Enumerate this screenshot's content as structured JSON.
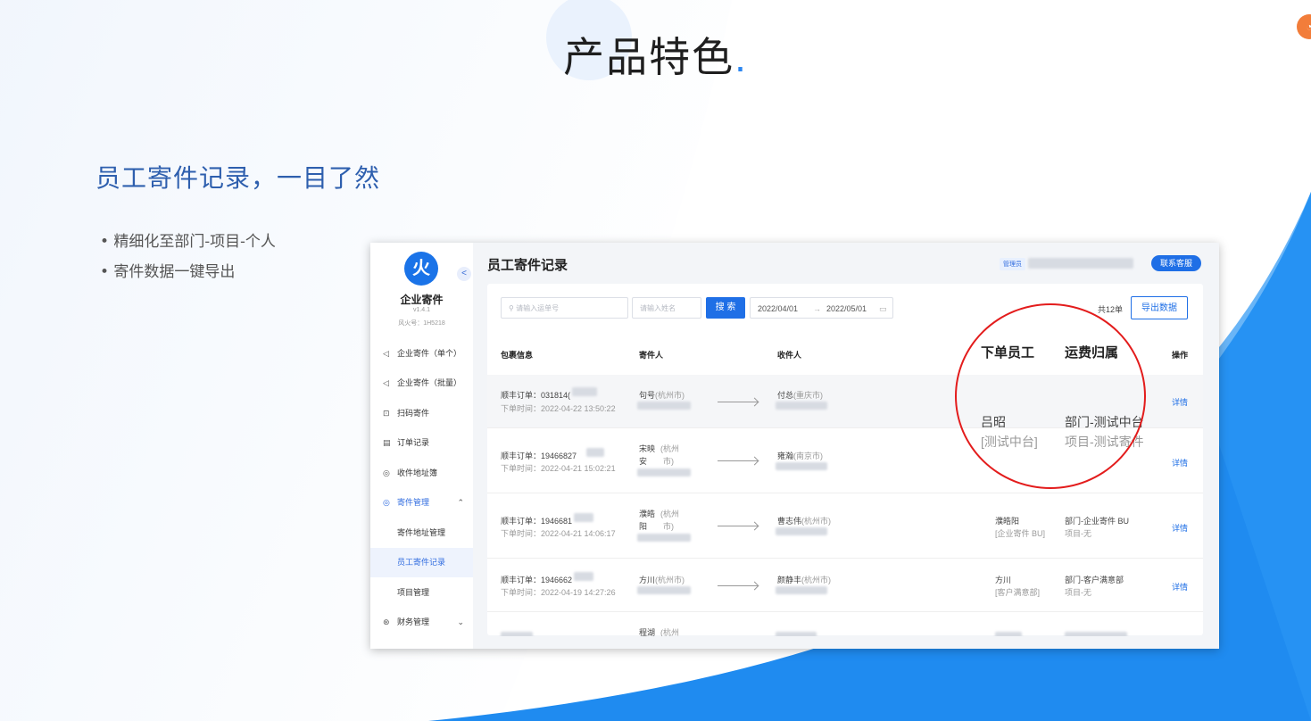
{
  "slide": {
    "title": "产品特色",
    "title_dot": ".",
    "subtitle": "员工寄件记录，一目了然",
    "bullets": [
      "• 精细化至部门-项目-个人",
      "• 寄件数据一键导出"
    ],
    "accent_color": "#2b86f0",
    "annotation_color": "#e31c1c"
  },
  "app": {
    "logo_char": "火",
    "collapse_icon": "chevron-left-icon",
    "name": "企业寄件",
    "version": "v1.4.1",
    "id": "风火号：1H5218",
    "nav": [
      {
        "icon": "send-icon",
        "glyph": "◁",
        "label": "企业寄件（单个）"
      },
      {
        "icon": "send-batch-icon",
        "glyph": "◁",
        "label": "企业寄件（批量）"
      },
      {
        "icon": "scan-icon",
        "glyph": "⊡",
        "label": "扫码寄件"
      },
      {
        "icon": "order-icon",
        "glyph": "▤",
        "label": "订单记录"
      },
      {
        "icon": "location-icon",
        "glyph": "◎",
        "label": "收件地址簿"
      },
      {
        "icon": "manage-icon",
        "glyph": "◎",
        "label": "寄件管理",
        "caret": "⌃"
      },
      {
        "label": "寄件地址管理"
      },
      {
        "label": "员工寄件记录"
      },
      {
        "label": "项目管理"
      },
      {
        "icon": "finance-icon",
        "glyph": "⊛",
        "label": "财务管理",
        "caret": "⌄"
      }
    ]
  },
  "header": {
    "title": "员工寄件记录",
    "role": "管理员",
    "contact_label": "联系客服"
  },
  "toolbar": {
    "waybill_placeholder": "请输入运单号",
    "name_placeholder": "请输入姓名",
    "search_label": "搜 索",
    "date_start": "2022/04/01",
    "date_sep": "→",
    "date_end": "2022/05/01",
    "total": "共12单",
    "export_label": "导出数据"
  },
  "table": {
    "headers": {
      "package": "包裹信息",
      "sender": "寄件人",
      "receiver": "收件人",
      "employee": "下单员工",
      "billing": "运费归属",
      "action": "操作"
    },
    "rows": [
      {
        "order": "顺丰订单：031814(",
        "time": "下单时间：2022-04-22 13:50:22",
        "sender": "句号",
        "sender_city": "(杭州市)",
        "receiver": "付总",
        "receiver_city": "(重庆市)",
        "emp": "吕昭",
        "emp_dept": "[测试中台]",
        "dept": "部门-测试中台",
        "project": "项目-测试寄件",
        "action": "详情"
      },
      {
        "order": "顺丰订单：19466827",
        "time": "下单时间：2022-04-21 15:02:21",
        "sender_a": "宋映",
        "sender_b": "安",
        "sender_city_a": "(杭州",
        "sender_city_b": "市)",
        "receiver": "雍瀚",
        "receiver_city": "(南京市)",
        "action": "详情"
      },
      {
        "order": "顺丰订单：1946681",
        "time": "下单时间：2022-04-21 14:06:17",
        "sender_a": "濮皓",
        "sender_b": "阳",
        "sender_city_a": "(杭州",
        "sender_city_b": "市)",
        "receiver": "曹志伟",
        "receiver_city": "(杭州市)",
        "emp": "濮皓阳",
        "emp_dept": "[企业寄件 BU]",
        "dept": "部门-企业寄件 BU",
        "project": "项目-无",
        "action": "详情"
      },
      {
        "order": "顺丰订单：1946662",
        "time": "下单时间：2022-04-19 14:27:26",
        "sender": "方川",
        "sender_city": "(杭州市)",
        "receiver": "颜静丰",
        "receiver_city": "(杭州市)",
        "emp": "方川",
        "emp_dept": "[客户满意部]",
        "dept": "部门-客户满意部",
        "project": "项目-无",
        "action": "详情"
      },
      {
        "sender_a": "程湖",
        "sender_city_a": "(杭州"
      }
    ]
  }
}
